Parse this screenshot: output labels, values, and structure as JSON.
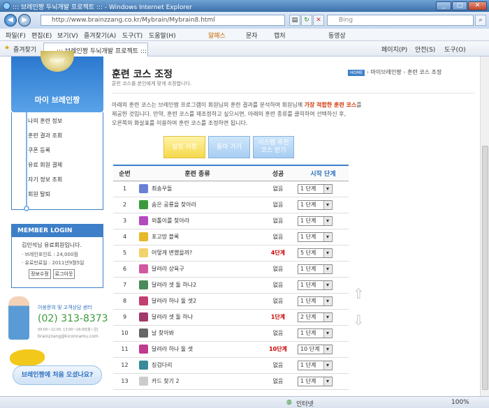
{
  "browser": {
    "title": "::: 브레인짱 두뇌개발 프로젝트 ::: - Windows Internet Explorer",
    "url": "http://www.brainzzang.co.kr/Mybrain/Mybrain8.html",
    "search_placeholder": "Bing",
    "tab_title": "::: 브레인짱 두뇌개발 프로젝트 :::",
    "favorites": "즐겨찾기",
    "menus": [
      "파일(F)",
      "편집(E)",
      "보기(V)",
      "즐겨찾기(A)",
      "도구(T)",
      "도움말(H)"
    ],
    "toolbar2": [
      "알패스",
      "문자",
      "캡처",
      "동영상"
    ],
    "cmdbar": [
      "페이지(P)",
      "안전(S)",
      "도구(O)"
    ],
    "status": "인터넷",
    "zoom": "100%"
  },
  "sidebar": {
    "start_label": "START",
    "box_title": "마이 브레인짱",
    "items": [
      "나의 훈련 정보",
      "훈련 결과 조회",
      "쿠폰 등록",
      "유료 회원 결제",
      "자기 정보 조회",
      "회원 탈퇴"
    ],
    "login": {
      "title": "MEMBER LOGIN",
      "greeting": "김민석님 유료회원입니다.",
      "points": "· 브레인포인트 : 24,000점",
      "expiry": "· 유료만료일 : 2011년9월5일",
      "btn_edit": "정보수정",
      "btn_logout": "로그아웃"
    },
    "contact": {
      "label": "이용문의 및 고객상담 센터",
      "phone": "(02) 313-8373",
      "hours": "09:00~12:00, 13:00~18:00[월~금]",
      "email": "brainzzang@kiconnamu.com"
    },
    "banner": "브레인짱에 처음 오셨나요?"
  },
  "page": {
    "title": "훈련 코스 조정",
    "subtitle": "훈련 코스를 본인에게 맞게 조정합니다.",
    "breadcrumb_home": "HOME",
    "breadcrumb_1": "마이브레인짱",
    "breadcrumb_2": "훈련 코스 조정",
    "desc1": "아래의 훈련 코스는 브레인짱 프로그램이 회원님의 훈련 결과를 분석하여 회원님께 ",
    "desc1_hl": "가장 적합한 훈련 코스",
    "desc1_end": "를",
    "desc2": "제공한 것입니다. 만약, 훈련 코스를 재조정하고 싶으시면, 아래의 훈련 종류를 클릭하여 선택하신 후,",
    "desc3": "오른쪽의 화살표를 이용하여 훈련 코스를 조정하면 됩니다.",
    "btn_save": "설정 저장",
    "btn_back": "돌아 가기",
    "btn_reset": "시스템 추천 코스 받기"
  },
  "table": {
    "headers": [
      "순번",
      "훈련 종류",
      "성공",
      "시작 단계"
    ],
    "rows": [
      {
        "n": "1",
        "name": "최송우돌",
        "status": "없음",
        "stage": "1 단계",
        "icon": "#6a7fd6"
      },
      {
        "n": "2",
        "name": "숨은 공룡을 찾아라",
        "status": "없음",
        "stage": "1 단계",
        "icon": "#3c9a3c"
      },
      {
        "n": "3",
        "name": "외톨이를 찾아라",
        "status": "없음",
        "stage": "1 단계",
        "icon": "#b44ac0"
      },
      {
        "n": "4",
        "name": "포고망 블록",
        "status": "없음",
        "stage": "1 단계",
        "icon": "#e6b82a"
      },
      {
        "n": "5",
        "name": "어떻게 변했을까?",
        "status": "4단계",
        "stage": "5 단계",
        "icon": "#f2d26a"
      },
      {
        "n": "6",
        "name": "달려라 상육구",
        "status": "없음",
        "stage": "1 단계",
        "icon": "#d05aa0"
      },
      {
        "n": "7",
        "name": "달려라 셋 둘 하나2",
        "status": "없음",
        "stage": "1 단계",
        "icon": "#4a8a5a"
      },
      {
        "n": "8",
        "name": "달려라 하나 둘 셋2",
        "status": "없음",
        "stage": "1 단계",
        "icon": "#c04070"
      },
      {
        "n": "9",
        "name": "달려라 셋 둘 하나",
        "status": "1단계",
        "stage": "2 단계",
        "icon": "#a03a6a"
      },
      {
        "n": "10",
        "name": "날 찾아봐",
        "status": "없음",
        "stage": "1 단계",
        "icon": "#666666"
      },
      {
        "n": "11",
        "name": "달려라 하나 둘 셋",
        "status": "10단계",
        "stage": "10 단계",
        "icon": "#c03a90"
      },
      {
        "n": "12",
        "name": "징검다리",
        "status": "없음",
        "stage": "1 단계",
        "icon": "#3a8a9a"
      },
      {
        "n": "13",
        "name": "카드 찾기 2",
        "status": "없음",
        "stage": "1 단계",
        "icon": "#cccccc"
      }
    ]
  }
}
